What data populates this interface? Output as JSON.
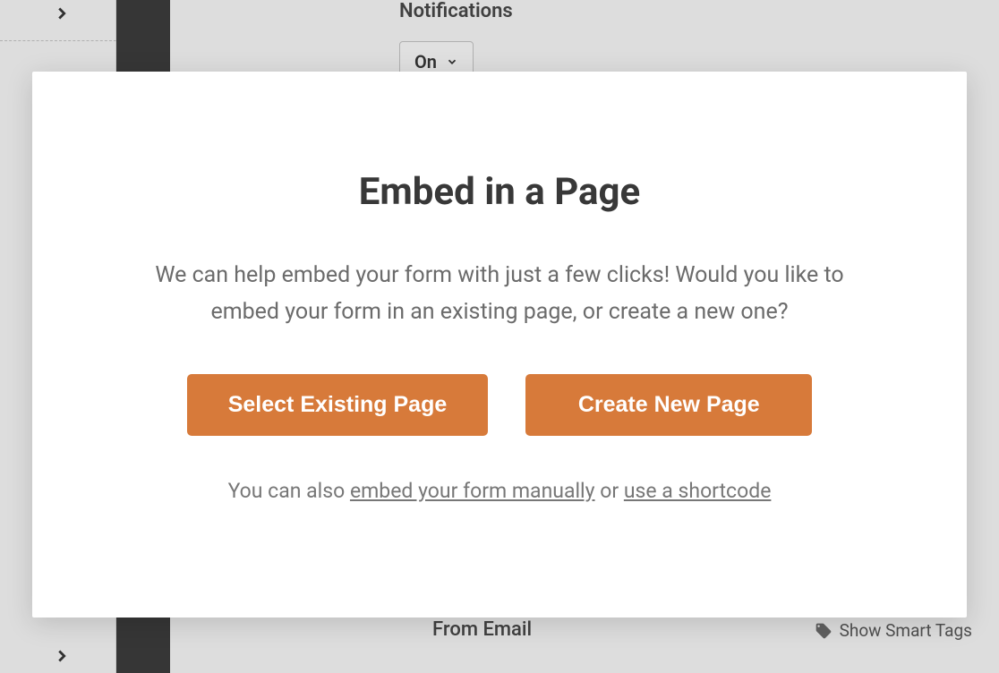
{
  "background": {
    "notifications_label": "Notifications",
    "on_select_value": "On",
    "from_email_label": "From Email",
    "smart_tags_label": "Show Smart Tags"
  },
  "modal": {
    "title": "Embed in a Page",
    "description": "We can help embed your form with just a few clicks! Would you like to embed your form in an existing page, or create a new one?",
    "select_existing_label": "Select Existing Page",
    "create_new_label": "Create New Page",
    "footer_prefix": "You can also ",
    "link_embed_manually": "embed your form manually",
    "footer_or": " or ",
    "link_shortcode": "use a shortcode"
  }
}
